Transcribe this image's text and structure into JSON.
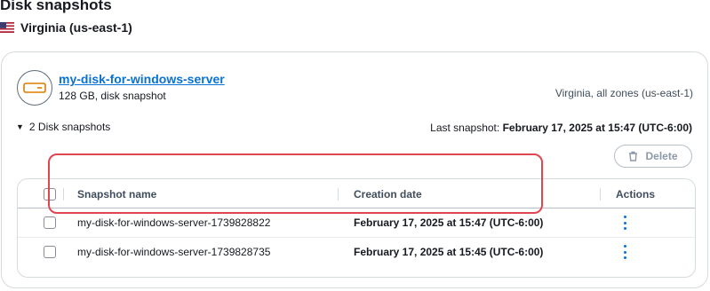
{
  "page": {
    "title": "Disk snapshots"
  },
  "region": {
    "label": "Virginia (us-east-1)",
    "flag_icon": "us-flag-icon"
  },
  "disk": {
    "name": "my-disk-for-windows-server",
    "subtitle": "128 GB, disk snapshot",
    "zone": "Virginia, all zones (us-east-1)"
  },
  "snapshots": {
    "toggle_label": "2 Disk snapshots",
    "last_prefix": "Last snapshot:",
    "last_value": "February 17, 2025 at 15:47 (UTC-6:00)",
    "delete_label": "Delete"
  },
  "table": {
    "columns": [
      "Snapshot name",
      "Creation date",
      "Actions"
    ],
    "rows": [
      {
        "name": "my-disk-for-windows-server-1739828822",
        "date": "February 17, 2025 at 15:47 (UTC-6:00)"
      },
      {
        "name": "my-disk-for-windows-server-1739828735",
        "date": "February 17, 2025 at 15:45 (UTC-6:00)"
      }
    ]
  },
  "colors": {
    "accent": "#0972d3",
    "highlight": "#e0464f",
    "text": "#16191f"
  }
}
